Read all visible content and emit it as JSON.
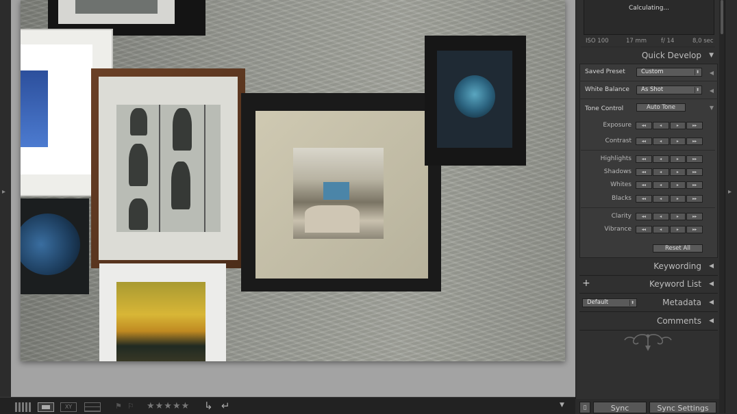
{
  "histogram": {
    "status": "Calculating..."
  },
  "camera_info": {
    "iso": "ISO 100",
    "focal": "17 mm",
    "aperture": "f/ 14",
    "shutter": "8,0 sec"
  },
  "quick_develop": {
    "title": "Quick Develop",
    "saved_preset": {
      "label": "Saved Preset",
      "value": "Custom"
    },
    "white_balance": {
      "label": "White Balance",
      "value": "As Shot"
    },
    "tone_control": {
      "label": "Tone Control",
      "auto_tone": "Auto Tone"
    },
    "adjustments": [
      "Exposure",
      "Contrast",
      "Highlights",
      "Shadows",
      "Whites",
      "Blacks",
      "Clarity",
      "Vibrance"
    ],
    "reset_all": "Reset All"
  },
  "panels": {
    "keywording": "Keywording",
    "keyword_list": "Keyword List",
    "keyword_list_add": "+",
    "metadata": "Metadata",
    "metadata_preset": "Default",
    "comments": "Comments"
  },
  "sync": {
    "sync": "Sync",
    "sync_settings": "Sync Settings"
  },
  "toolbar": {
    "compare_label": "XY",
    "rating": "★★★★★"
  },
  "colors": {
    "panel_bg": "#303030",
    "accent_text": "#bdbdbd",
    "canvas_bg": "#a3a3a3"
  },
  "icons": [
    "grid-view-icon",
    "loupe-view-icon",
    "compare-view-icon",
    "survey-view-icon",
    "flag-icon",
    "reject-flag-icon",
    "rotate-left-icon",
    "rotate-right-icon",
    "ornament-icon",
    "expand-triangle-icon",
    "left-panel-arrow-icon",
    "right-panel-arrow-icon"
  ]
}
